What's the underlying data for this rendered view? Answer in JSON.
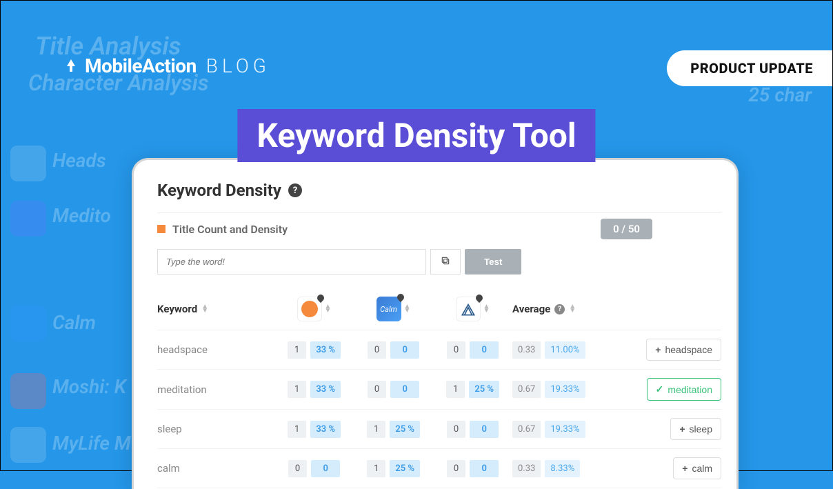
{
  "bg": {
    "title_analysis": "Title Analysis",
    "character_analysis": "Character Analysis",
    "heads": "Heads",
    "medito": "Medito",
    "calm": "Calm",
    "moshi": "Moshi: K",
    "mylife": "MyLife M",
    "chars": "25 char"
  },
  "logo": {
    "brand": "MobileAction",
    "blog": "BLOG"
  },
  "badge": "PRODUCT UPDATE",
  "hero_title": "Keyword Density Tool",
  "panel": {
    "title": "Keyword Density",
    "section_label": "Title Count and Density",
    "counter": "0 / 50",
    "input_placeholder": "Type the word!",
    "test_btn": "Test"
  },
  "columns": {
    "keyword": "Keyword",
    "average": "Average",
    "app_calm_label": "Calm"
  },
  "rows": [
    {
      "keyword": "headspace",
      "apps": [
        {
          "count": "1",
          "pct": "33 %"
        },
        {
          "count": "0",
          "pct": "0"
        },
        {
          "count": "0",
          "pct": "0"
        }
      ],
      "avg_count": "0.33",
      "avg_pct": "11.00%",
      "action_label": "headspace",
      "added": false
    },
    {
      "keyword": "meditation",
      "apps": [
        {
          "count": "1",
          "pct": "33 %"
        },
        {
          "count": "0",
          "pct": "0"
        },
        {
          "count": "1",
          "pct": "25 %"
        }
      ],
      "avg_count": "0.67",
      "avg_pct": "19.33%",
      "action_label": "meditation",
      "added": true
    },
    {
      "keyword": "sleep",
      "apps": [
        {
          "count": "1",
          "pct": "33 %"
        },
        {
          "count": "1",
          "pct": "25 %"
        },
        {
          "count": "0",
          "pct": "0"
        }
      ],
      "avg_count": "0.67",
      "avg_pct": "19.33%",
      "action_label": "sleep",
      "added": false
    },
    {
      "keyword": "calm",
      "apps": [
        {
          "count": "0",
          "pct": "0"
        },
        {
          "count": "1",
          "pct": "25 %"
        },
        {
          "count": "0",
          "pct": "0"
        }
      ],
      "avg_count": "0.33",
      "avg_pct": "8.33%",
      "action_label": "calm",
      "added": false
    }
  ]
}
